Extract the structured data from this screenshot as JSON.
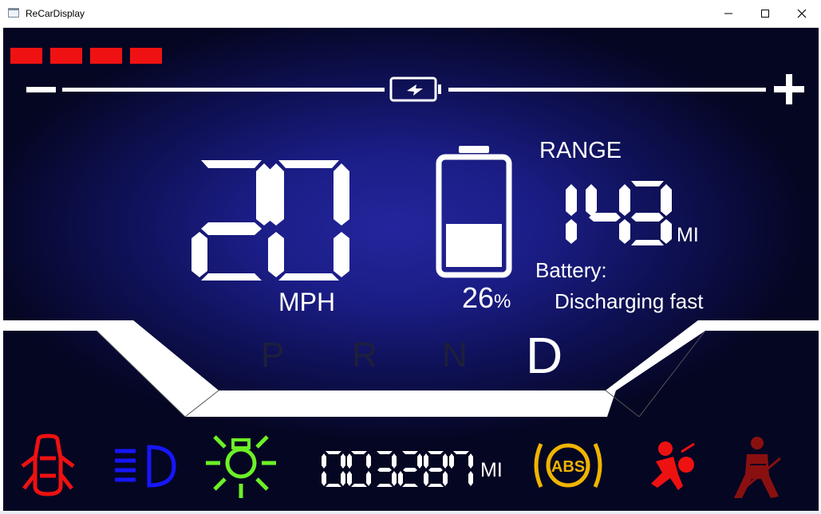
{
  "window": {
    "title": "ReCarDisplay",
    "controls": [
      "minimize",
      "maximize",
      "close"
    ]
  },
  "indicators_top": {
    "segment_count": 4,
    "color": "#f01212"
  },
  "charge_bar": {
    "minus": "−",
    "plus": "+",
    "icon": "lightning-battery-icon"
  },
  "speed": {
    "value": "20",
    "unit": "MPH"
  },
  "battery": {
    "percent": "26",
    "percent_sign": "%",
    "level": 0.26,
    "status_label": "Battery:",
    "status_value": "Discharging fast"
  },
  "range": {
    "label": "RANGE",
    "value": "143",
    "unit": "MI"
  },
  "gears": {
    "items": [
      "P",
      "R",
      "N",
      "D"
    ],
    "selected": "D"
  },
  "odometer": {
    "value": "003287",
    "unit": "MI"
  },
  "warning_icons": [
    {
      "name": "door-open-icon",
      "color": "#ee1111"
    },
    {
      "name": "headlight-high-beam-icon",
      "color": "#1616ff"
    },
    {
      "name": "exterior-light-icon",
      "color": "#6cf026"
    },
    {
      "name": "abs-icon",
      "color": "#f0b400",
      "text": "ABS"
    },
    {
      "name": "airbag-icon",
      "color": "#ee1111"
    },
    {
      "name": "seatbelt-icon",
      "color": "#8a1010"
    }
  ],
  "colors": {
    "dash_center": "#24259c",
    "dash_edge": "#050622"
  }
}
